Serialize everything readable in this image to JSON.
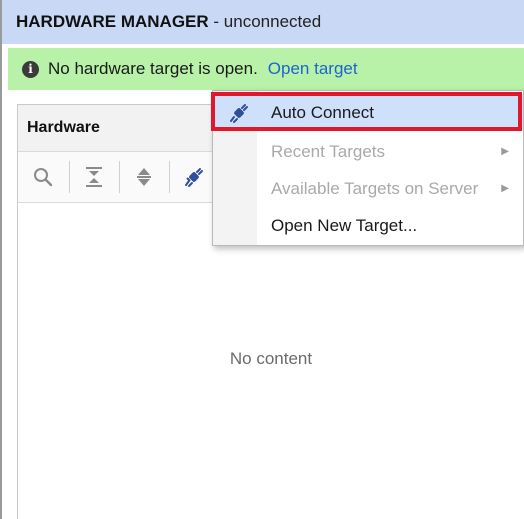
{
  "header": {
    "title": "HARDWARE MANAGER",
    "status": "- unconnected"
  },
  "banner": {
    "message": "No hardware target is open.",
    "link": "Open target"
  },
  "panel": {
    "title": "Hardware",
    "empty_text": "No content"
  },
  "toolbar": {
    "tools": [
      "search-icon",
      "collapse-all-icon",
      "expand-all-icon",
      "auto-connect-icon"
    ]
  },
  "menu": {
    "items": [
      {
        "label": "Auto Connect",
        "enabled": true,
        "highlighted": true,
        "icon": "auto-connect-icon"
      },
      {
        "label": "Recent Targets",
        "enabled": false,
        "submenu": true
      },
      {
        "label": "Available Targets on Server",
        "enabled": false,
        "submenu": true
      },
      {
        "label": "Open New Target...",
        "enabled": true
      }
    ]
  },
  "colors": {
    "header_bg": "#c8d8f5",
    "banner_bg": "#b7f2a8",
    "link": "#1f63d0",
    "highlight": "#e0182a",
    "menu_hover": "#cfe0fa"
  }
}
